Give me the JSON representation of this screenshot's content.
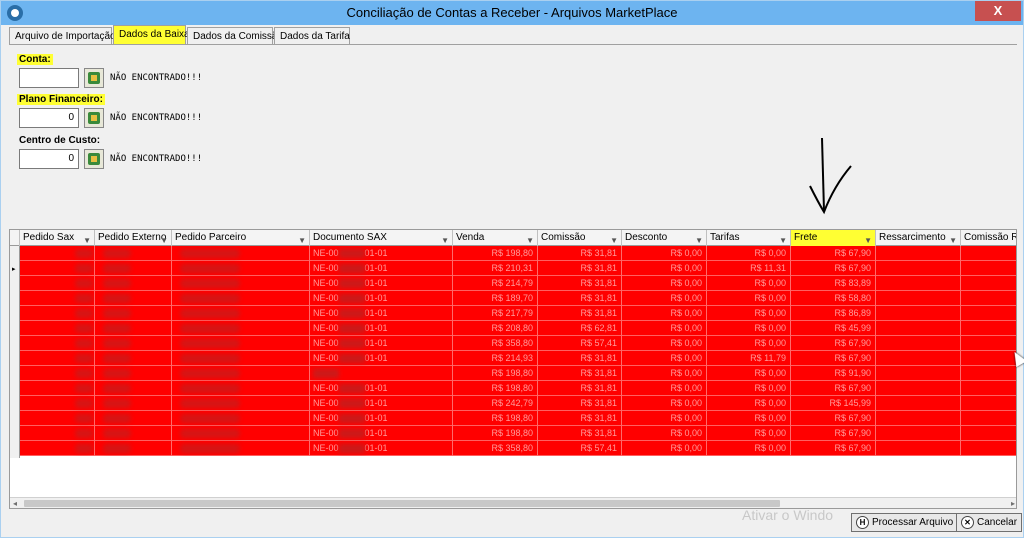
{
  "window": {
    "title": "Conciliação de Contas a Receber - Arquivos MarketPlace",
    "close_label": "X"
  },
  "tabs": [
    {
      "label": "Arquivo de Importação",
      "active": false
    },
    {
      "label": "Dados da Baixa",
      "active": true
    },
    {
      "label": "Dados da Comissão",
      "active": false
    },
    {
      "label": "Dados da Tarifa",
      "active": false
    }
  ],
  "form": {
    "conta": {
      "label": "Conta:",
      "value": "",
      "message": "NÃO ENCONTRADO!!!"
    },
    "plano": {
      "label": "Plano Financeiro:",
      "value": "0",
      "message": "NÃO ENCONTRADO!!!"
    },
    "centro": {
      "label": "Centro de Custo:",
      "value": "0",
      "message": "NÃO ENCONTRADO!!!"
    }
  },
  "grid": {
    "columns": [
      {
        "label": "Pedido Sax",
        "filter_icon": "▼"
      },
      {
        "label": "Pedido Externo",
        "filter_icon": "▼"
      },
      {
        "label": "Pedido Parceiro",
        "filter_icon": "▼"
      },
      {
        "label": "Documento SAX",
        "filter_icon": "▼"
      },
      {
        "label": "Venda",
        "filter_icon": "▼"
      },
      {
        "label": "Comissão",
        "filter_icon": "▼"
      },
      {
        "label": "Desconto",
        "filter_icon": "▼"
      },
      {
        "label": "Tarifas",
        "filter_icon": "▼"
      },
      {
        "label": "Frete",
        "filter_icon": "▼"
      },
      {
        "label": "Ressarcimento",
        "filter_icon": "▼"
      },
      {
        "label": "Comissão Ress",
        "filter_icon": ""
      }
    ],
    "highlight_color": "#ff0000",
    "rows": [
      {
        "doc": "NE-00",
        "doc2": "01-01",
        "venda": "R$ 198,80",
        "comissao": "R$ 31,81",
        "desconto": "R$ 0,00",
        "tarifas": "R$ 0,00",
        "frete": "R$ 67,90"
      },
      {
        "doc": "NE-00",
        "doc2": "01-01",
        "venda": "R$ 210,31",
        "comissao": "R$ 31,81",
        "desconto": "R$ 0,00",
        "tarifas": "R$ 11,31",
        "frete": "R$ 67,90"
      },
      {
        "doc": "NE-00",
        "doc2": "01-01",
        "venda": "R$ 214,79",
        "comissao": "R$ 31,81",
        "desconto": "R$ 0,00",
        "tarifas": "R$ 0,00",
        "frete": "R$ 83,89"
      },
      {
        "doc": "NE-00",
        "doc2": "01-01",
        "venda": "R$ 189,70",
        "comissao": "R$ 31,81",
        "desconto": "R$ 0,00",
        "tarifas": "R$ 0,00",
        "frete": "R$ 58,80"
      },
      {
        "doc": "NE-00",
        "doc2": "01-01",
        "venda": "R$ 217,79",
        "comissao": "R$ 31,81",
        "desconto": "R$ 0,00",
        "tarifas": "R$ 0,00",
        "frete": "R$ 86,89"
      },
      {
        "doc": "NE-00",
        "doc2": "01-01",
        "venda": "R$ 208,80",
        "comissao": "R$ 62,81",
        "desconto": "R$ 0,00",
        "tarifas": "R$ 0,00",
        "frete": "R$ 45,99"
      },
      {
        "doc": "NE-00",
        "doc2": "01-01",
        "venda": "R$ 358,80",
        "comissao": "R$ 57,41",
        "desconto": "R$ 0,00",
        "tarifas": "R$ 0,00",
        "frete": "R$ 67,90"
      },
      {
        "doc": "NE-00",
        "doc2": "01-01",
        "venda": "R$ 214,93",
        "comissao": "R$ 31,81",
        "desconto": "R$ 0,00",
        "tarifas": "R$ 11,79",
        "frete": "R$ 67,90"
      },
      {
        "doc": "",
        "doc2": "",
        "venda": "R$ 198,80",
        "comissao": "R$ 31,81",
        "desconto": "R$ 0,00",
        "tarifas": "R$ 0,00",
        "frete": "R$ 91,90"
      },
      {
        "doc": "NE-00",
        "doc2": "01-01",
        "venda": "R$ 198,80",
        "comissao": "R$ 31,81",
        "desconto": "R$ 0,00",
        "tarifas": "R$ 0,00",
        "frete": "R$ 67,90"
      },
      {
        "doc": "NE-00",
        "doc2": "01-01",
        "venda": "R$ 242,79",
        "comissao": "R$ 31,81",
        "desconto": "R$ 0,00",
        "tarifas": "R$ 0,00",
        "frete": "R$ 145,99"
      },
      {
        "doc": "NE-00",
        "doc2": "01-01",
        "venda": "R$ 198,80",
        "comissao": "R$ 31,81",
        "desconto": "R$ 0,00",
        "tarifas": "R$ 0,00",
        "frete": "R$ 67,90"
      },
      {
        "doc": "NE-00",
        "doc2": "01-01",
        "venda": "R$ 198,80",
        "comissao": "R$ 31,81",
        "desconto": "R$ 0,00",
        "tarifas": "R$ 0,00",
        "frete": "R$ 67,90"
      },
      {
        "doc": "NE-00",
        "doc2": "01-01",
        "venda": "R$ 358,80",
        "comissao": "R$ 57,41",
        "desconto": "R$ 0,00",
        "tarifas": "R$ 0,00",
        "frete": "R$ 67,90"
      }
    ]
  },
  "scroll": {
    "left_arrow": "◂",
    "right_arrow": "▸"
  },
  "watermark": "Ativar o Windo",
  "buttons": {
    "process": {
      "label": "Processar Arquivo",
      "icon": "H"
    },
    "cancel": {
      "label": "Cancelar",
      "icon": "✕"
    }
  }
}
